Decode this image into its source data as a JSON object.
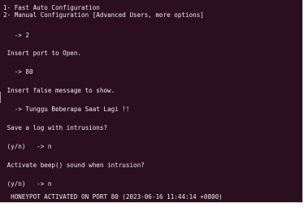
{
  "terminal": {
    "lines": [
      "1- Fast Auto Configuration",
      "2- Manual Configuration [Advanced Users, more options]",
      "   -> 2",
      " Insert port to Open.",
      "   -> 80",
      " Insert false message to show.",
      "   -> Tunggu Beberapa Saat Lagi !!",
      " Save a log with intrusions?",
      " (y/n)   -> n",
      " Activate beep() sound when intrusion?",
      " (y/n)   -> n",
      "  HONEYPOT ACTIVATED ON PORT 80 (2023-06-16 11:44:14 +0800)"
    ]
  },
  "colors": {
    "background": "#2c0f1f",
    "text": "#ececec"
  }
}
